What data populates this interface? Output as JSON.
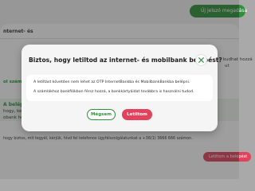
{
  "background": {
    "new_button_label": "Új jelszó megadása",
    "section_heading": "nternet- és",
    "link_text": "ol számlá",
    "right_snippet_1": "kudhat hozzá",
    "right_snippet_2": "ut",
    "band_heading": "A belépést",
    "band_line_1": "hogy, kérjük, a",
    "band_line_2": "obank hozzáfé",
    "footer_text": "hogy biztos, mit tegyél, kérjük, hívd fel telefonos ügyfélszolgálatunkat a +36(1) 3666 666 számon.",
    "cancel_button_label": "Letiltom a belépést"
  },
  "modal": {
    "title": "Biztos, hogy letiltod az internet- és mobilbank belépést?",
    "message_line_1": "A letiltást követően nem lehet az OTP InternetBankba és MobilbankBankba belépni.",
    "message_line_2": "A számlákhoz bankfiókban férsz hozzá, a bankkártyáidat továbbra is használni tudod.",
    "cancel_label": "Mégsem",
    "confirm_label": "Letiltom"
  },
  "colors": {
    "primary_green": "#2f8f3a",
    "danger_red": "#e2425c"
  }
}
